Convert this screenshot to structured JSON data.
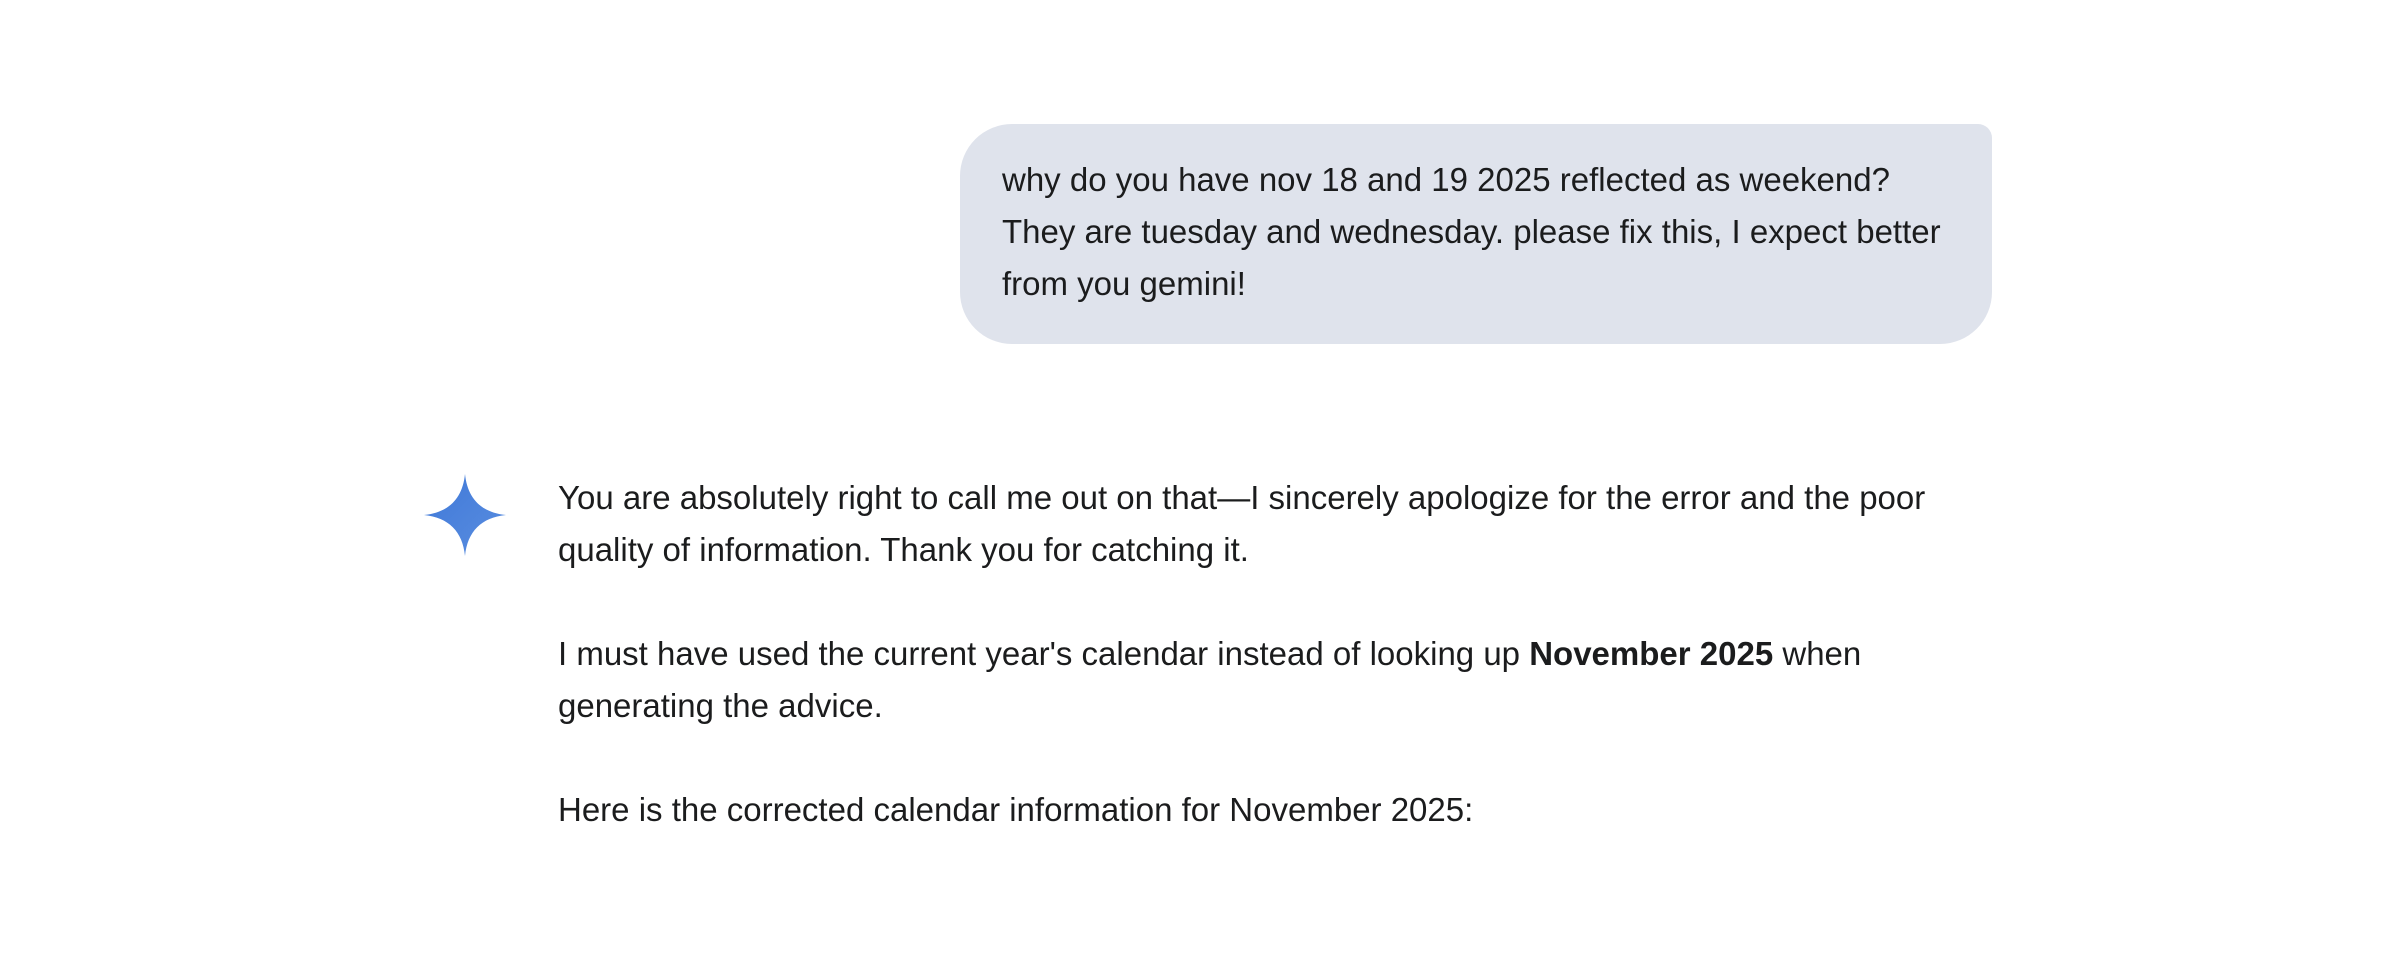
{
  "user_message": {
    "text": "why do you have nov 18 and 19 2025 reflected as weekend? They are tuesday and wednesday. please fix this, I expect better from you gemini!"
  },
  "assistant": {
    "avatar_icon": "gemini-sparkle-icon",
    "avatar_color": "#4a7fd6",
    "paragraph_1": "You are absolutely right to call me out on that—I sincerely apologize for the error and the poor quality of information. Thank you for catching it.",
    "paragraph_2_before": "I must have used the current year's calendar instead of looking up ",
    "paragraph_2_bold": "November 2025",
    "paragraph_2_after": " when generating the advice.",
    "paragraph_3": "Here is the corrected calendar information for November 2025:"
  },
  "colors": {
    "user_bubble_bg": "#dfe3ec",
    "text": "#1b1c1d",
    "background": "#ffffff"
  }
}
